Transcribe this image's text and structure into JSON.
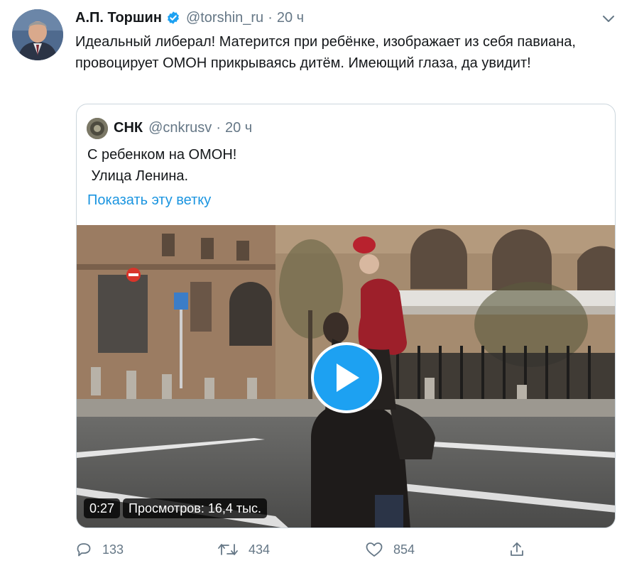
{
  "tweet": {
    "author_name": "А.П. Торшин",
    "handle": "@torshin_ru",
    "separator": "·",
    "time": "20 ч",
    "text": "Идеальный либерал! Матерится при ребёнке, изображает из себя павиана, провоцирует ОМОН прикрываясь дитём. Имеющий глаза, да увидит!"
  },
  "quote": {
    "author_name": "СНК",
    "handle": "@cnkrusv",
    "separator": "·",
    "time": "20 ч",
    "text": "С ребенком на ОМОН!\n Улица Ленина.",
    "show_thread": "Показать эту ветку",
    "video": {
      "duration": "0:27",
      "views": "Просмотров: 16,4 тыс."
    }
  },
  "actions": {
    "replies": "133",
    "retweets": "434",
    "likes": "854"
  },
  "colors": {
    "accent": "#1da1f2",
    "link": "#1b95e0",
    "secondary_text": "#657786",
    "border": "#ccd6dd"
  },
  "icons": [
    "verified-badge-icon",
    "chevron-down-icon",
    "play-icon",
    "reply-icon",
    "retweet-icon",
    "like-icon",
    "share-icon"
  ]
}
